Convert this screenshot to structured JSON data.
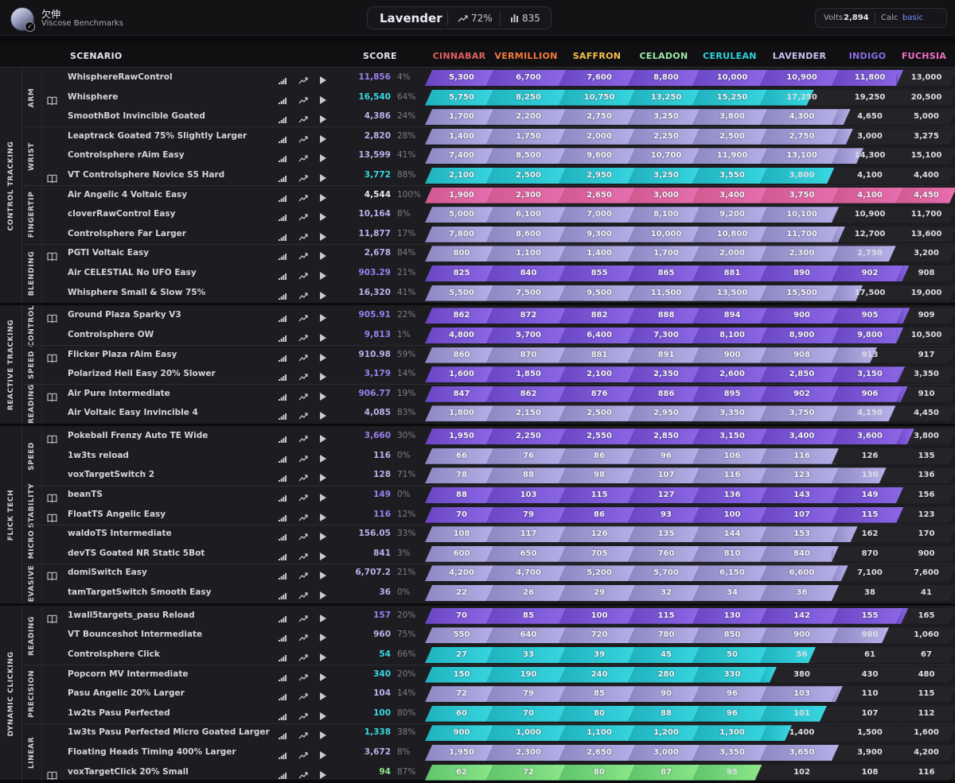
{
  "header": {
    "user_name": "欠伸",
    "benchmark_name": "Viscose Benchmarks",
    "rank_name": "Lavender",
    "progress": "72%",
    "score_total": "835",
    "volts_label": "Volts",
    "volts_value": "2,894",
    "calc_label": "Calc",
    "calc_value": "basic"
  },
  "table": {
    "scenario_header": "SCENARIO",
    "score_header": "SCORE",
    "ranks": [
      {
        "name": "CINNABAR",
        "color": "#e0605e"
      },
      {
        "name": "VERMILLION",
        "color": "#f27a3a"
      },
      {
        "name": "SAFFRON",
        "color": "#f3c14c"
      },
      {
        "name": "CELADON",
        "color": "#9ee8a8"
      },
      {
        "name": "CERULEAN",
        "color": "#2fd2dc"
      },
      {
        "name": "LAVENDER",
        "color": "#c9c1ef"
      },
      {
        "name": "INDIGO",
        "color": "#8b6de2"
      },
      {
        "name": "FUCHSIA",
        "color": "#f06ec2"
      }
    ],
    "categories": [
      {
        "name": "CONTROL TRACKING",
        "subcategories": [
          {
            "name": "ARM",
            "scenarios": [
              {
                "name": "WhisphereRawControl",
                "score": "11,856",
                "pct": "4%",
                "book": false,
                "ranks": [
                  "5,300",
                  "6,700",
                  "7,600",
                  "8,800",
                  "10,000",
                  "10,900",
                  "11,800",
                  "13,000"
                ]
              },
              {
                "name": "Whisphere",
                "score": "16,540",
                "pct": "64%",
                "book": true,
                "ranks": [
                  "5,750",
                  "8,250",
                  "10,750",
                  "13,250",
                  "15,250",
                  "17,250",
                  "19,250",
                  "20,500"
                ]
              },
              {
                "name": "SmoothBot Invincible Goated",
                "score": "4,386",
                "pct": "24%",
                "book": false,
                "ranks": [
                  "1,700",
                  "2,200",
                  "2,750",
                  "3,250",
                  "3,800",
                  "4,300",
                  "4,650",
                  "5,000"
                ]
              }
            ]
          },
          {
            "name": "WRIST",
            "scenarios": [
              {
                "name": "Leaptrack Goated 75% Slightly Larger",
                "score": "2,820",
                "pct": "28%",
                "book": false,
                "ranks": [
                  "1,400",
                  "1,750",
                  "2,000",
                  "2,250",
                  "2,500",
                  "2,750",
                  "3,000",
                  "3,275"
                ]
              },
              {
                "name": "Controlsphere rAim Easy",
                "score": "13,599",
                "pct": "41%",
                "book": false,
                "ranks": [
                  "7,400",
                  "8,500",
                  "9,600",
                  "10,700",
                  "11,900",
                  "13,100",
                  "14,300",
                  "15,100"
                ]
              },
              {
                "name": "VT Controlsphere Novice S5 Hard",
                "score": "3,772",
                "pct": "88%",
                "book": true,
                "ranks": [
                  "2,100",
                  "2,500",
                  "2,950",
                  "3,250",
                  "3,550",
                  "3,800",
                  "4,100",
                  "4,400"
                ]
              }
            ]
          },
          {
            "name": "FINGERTIP",
            "scenarios": [
              {
                "name": "Air Angelic 4 Voltaic Easy",
                "score": "4,544",
                "pct": "100%",
                "book": false,
                "ranks": [
                  "1,900",
                  "2,300",
                  "2,650",
                  "3,000",
                  "3,400",
                  "3,750",
                  "4,100",
                  "4,450"
                ]
              },
              {
                "name": "cloverRawControl Easy",
                "score": "10,164",
                "pct": "8%",
                "book": false,
                "ranks": [
                  "5,000",
                  "6,100",
                  "7,000",
                  "8,100",
                  "9,200",
                  "10,100",
                  "10,900",
                  "11,700"
                ]
              },
              {
                "name": "Controlsphere Far Larger",
                "score": "11,877",
                "pct": "17%",
                "book": false,
                "ranks": [
                  "7,800",
                  "8,600",
                  "9,300",
                  "10,000",
                  "10,800",
                  "11,700",
                  "12,700",
                  "13,600"
                ]
              }
            ]
          },
          {
            "name": "BLENDING",
            "scenarios": [
              {
                "name": "PGTI Voltaic Easy",
                "score": "2,678",
                "pct": "84%",
                "book": true,
                "ranks": [
                  "800",
                  "1,100",
                  "1,400",
                  "1,700",
                  "2,000",
                  "2,300",
                  "2,750",
                  "3,200"
                ]
              },
              {
                "name": "Air CELESTIAL No UFO Easy",
                "score": "903.29",
                "pct": "21%",
                "book": false,
                "ranks": [
                  "825",
                  "840",
                  "855",
                  "865",
                  "881",
                  "890",
                  "902",
                  "908"
                ]
              },
              {
                "name": "Whisphere Small & Slow 75%",
                "score": "16,320",
                "pct": "41%",
                "book": false,
                "ranks": [
                  "5,500",
                  "7,500",
                  "9,500",
                  "11,500",
                  "13,500",
                  "15,500",
                  "17,500",
                  "19,000"
                ]
              }
            ]
          }
        ]
      },
      {
        "name": "REACTIVE TRACKING",
        "subcategories": [
          {
            "name": "CONTROL",
            "scenarios": [
              {
                "name": "Ground Plaza Sparky V3",
                "score": "905.91",
                "pct": "22%",
                "book": true,
                "ranks": [
                  "862",
                  "872",
                  "882",
                  "888",
                  "894",
                  "900",
                  "905",
                  "909"
                ]
              },
              {
                "name": "Controlsphere OW",
                "score": "9,813",
                "pct": "1%",
                "book": false,
                "ranks": [
                  "4,800",
                  "5,700",
                  "6,400",
                  "7,300",
                  "8,100",
                  "8,900",
                  "9,800",
                  "10,500"
                ]
              }
            ]
          },
          {
            "name": "SPEED",
            "scenarios": [
              {
                "name": "Flicker Plaza rAim Easy",
                "score": "910.98",
                "pct": "59%",
                "book": true,
                "ranks": [
                  "860",
                  "870",
                  "881",
                  "891",
                  "900",
                  "908",
                  "913",
                  "917"
                ]
              },
              {
                "name": "Polarized Hell Easy 20% Slower",
                "score": "3,179",
                "pct": "14%",
                "book": false,
                "ranks": [
                  "1,600",
                  "1,850",
                  "2,100",
                  "2,350",
                  "2,600",
                  "2,850",
                  "3,150",
                  "3,350"
                ]
              }
            ]
          },
          {
            "name": "READING",
            "scenarios": [
              {
                "name": "Air Pure Intermediate",
                "score": "906.77",
                "pct": "19%",
                "book": true,
                "ranks": [
                  "847",
                  "862",
                  "876",
                  "886",
                  "895",
                  "902",
                  "906",
                  "910"
                ]
              },
              {
                "name": "Air Voltaic Easy Invincible 4",
                "score": "4,085",
                "pct": "83%",
                "book": false,
                "ranks": [
                  "1,800",
                  "2,150",
                  "2,500",
                  "2,950",
                  "3,350",
                  "3,750",
                  "4,150",
                  "4,450"
                ]
              }
            ]
          }
        ]
      },
      {
        "name": "FLICK TECH",
        "subcategories": [
          {
            "name": "SPEED",
            "scenarios": [
              {
                "name": "Pokeball Frenzy Auto TE Wide",
                "score": "3,660",
                "pct": "30%",
                "book": true,
                "ranks": [
                  "1,950",
                  "2,250",
                  "2,550",
                  "2,850",
                  "3,150",
                  "3,400",
                  "3,600",
                  "3,800"
                ]
              },
              {
                "name": "1w3ts reload",
                "score": "116",
                "pct": "0%",
                "book": false,
                "ranks": [
                  "66",
                  "76",
                  "86",
                  "96",
                  "106",
                  "116",
                  "126",
                  "135"
                ]
              },
              {
                "name": "voxTargetSwitch 2",
                "score": "128",
                "pct": "71%",
                "book": false,
                "ranks": [
                  "78",
                  "88",
                  "98",
                  "107",
                  "116",
                  "123",
                  "130",
                  "136"
                ]
              }
            ]
          },
          {
            "name": "STABILITY",
            "scenarios": [
              {
                "name": "beanTS",
                "score": "149",
                "pct": "0%",
                "book": true,
                "ranks": [
                  "88",
                  "103",
                  "115",
                  "127",
                  "136",
                  "143",
                  "149",
                  "156"
                ]
              },
              {
                "name": "FloatTS Angelic Easy",
                "score": "116",
                "pct": "12%",
                "book": true,
                "ranks": [
                  "70",
                  "79",
                  "86",
                  "93",
                  "100",
                  "107",
                  "115",
                  "123"
                ]
              }
            ]
          },
          {
            "name": "MICRO",
            "scenarios": [
              {
                "name": "waldoTS Intermediate",
                "score": "156.05",
                "pct": "33%",
                "book": false,
                "ranks": [
                  "108",
                  "117",
                  "126",
                  "135",
                  "144",
                  "153",
                  "162",
                  "170"
                ]
              },
              {
                "name": "devTS Goated NR Static 5Bot",
                "score": "841",
                "pct": "3%",
                "book": false,
                "ranks": [
                  "600",
                  "650",
                  "705",
                  "760",
                  "810",
                  "840",
                  "870",
                  "900"
                ]
              }
            ]
          },
          {
            "name": "EVASIVE",
            "scenarios": [
              {
                "name": "domiSwitch Easy",
                "score": "6,707.2",
                "pct": "21%",
                "book": true,
                "ranks": [
                  "4,200",
                  "4,700",
                  "5,200",
                  "5,700",
                  "6,150",
                  "6,600",
                  "7,100",
                  "7,600"
                ]
              },
              {
                "name": "tamTargetSwitch Smooth Easy",
                "score": "36",
                "pct": "0%",
                "book": false,
                "ranks": [
                  "22",
                  "26",
                  "29",
                  "32",
                  "34",
                  "36",
                  "38",
                  "41"
                ]
              }
            ]
          }
        ]
      },
      {
        "name": "DYNAMIC CLICKING",
        "subcategories": [
          {
            "name": "READING",
            "scenarios": [
              {
                "name": "1wall5targets_pasu Reload",
                "score": "157",
                "pct": "20%",
                "book": true,
                "ranks": [
                  "70",
                  "85",
                  "100",
                  "115",
                  "130",
                  "142",
                  "155",
                  "165"
                ]
              },
              {
                "name": "VT Bounceshot Intermediate",
                "score": "960",
                "pct": "75%",
                "book": false,
                "ranks": [
                  "550",
                  "640",
                  "720",
                  "780",
                  "850",
                  "900",
                  "980",
                  "1,060"
                ]
              },
              {
                "name": "Controlsphere Click",
                "score": "54",
                "pct": "66%",
                "book": false,
                "ranks": [
                  "27",
                  "33",
                  "39",
                  "45",
                  "50",
                  "56",
                  "61",
                  "67"
                ]
              }
            ]
          },
          {
            "name": "PRECISION",
            "scenarios": [
              {
                "name": "Popcorn MV Intermediate",
                "score": "340",
                "pct": "20%",
                "book": false,
                "ranks": [
                  "150",
                  "190",
                  "240",
                  "280",
                  "330",
                  "380",
                  "430",
                  "480"
                ]
              },
              {
                "name": "Pasu Angelic 20% Larger",
                "score": "104",
                "pct": "14%",
                "book": false,
                "ranks": [
                  "72",
                  "79",
                  "85",
                  "90",
                  "96",
                  "103",
                  "110",
                  "115"
                ]
              },
              {
                "name": "1w2ts Pasu Perfected",
                "score": "100",
                "pct": "80%",
                "book": false,
                "ranks": [
                  "60",
                  "70",
                  "80",
                  "88",
                  "96",
                  "101",
                  "107",
                  "112"
                ]
              }
            ]
          },
          {
            "name": "LINEAR",
            "scenarios": [
              {
                "name": "1w3ts Pasu Perfected Micro Goated Larger",
                "score": "1,338",
                "pct": "38%",
                "book": false,
                "ranks": [
                  "900",
                  "1,000",
                  "1,100",
                  "1,200",
                  "1,300",
                  "1,400",
                  "1,500",
                  "1,600"
                ]
              },
              {
                "name": "Floating Heads Timing 400% Larger",
                "score": "3,672",
                "pct": "8%",
                "book": false,
                "ranks": [
                  "1,950",
                  "2,300",
                  "2,650",
                  "3,000",
                  "3,350",
                  "3,650",
                  "3,900",
                  "4,200"
                ]
              },
              {
                "name": "voxTargetClick 20% Small",
                "score": "94",
                "pct": "87%",
                "book": true,
                "ranks": [
                  "62",
                  "72",
                  "80",
                  "87",
                  "95",
                  "102",
                  "108",
                  "116"
                ]
              }
            ]
          }
        ]
      }
    ]
  }
}
